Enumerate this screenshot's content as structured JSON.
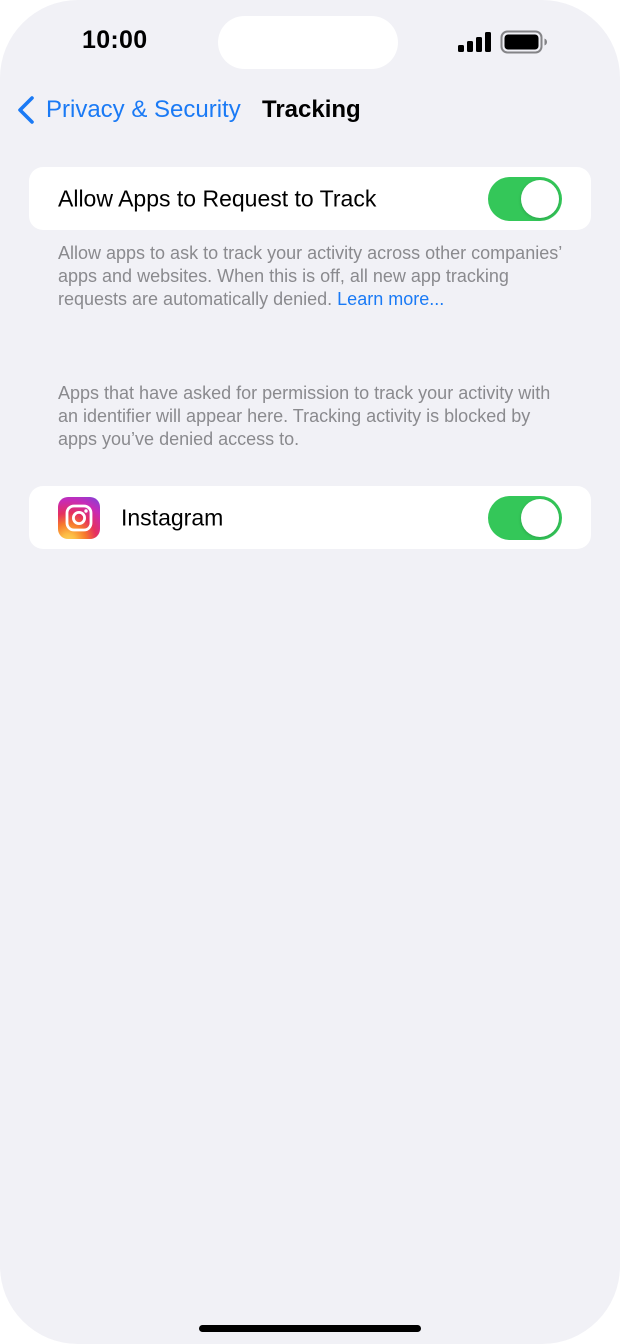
{
  "status_bar": {
    "time": "10:00",
    "signal_icon": "cellular-signal-icon",
    "battery_icon": "battery-icon"
  },
  "nav": {
    "back_label": "Privacy & Security",
    "back_icon": "chevron-left-icon",
    "title": "Tracking"
  },
  "allow_tracking": {
    "label": "Allow Apps to Request to Track",
    "enabled": true,
    "footnote_text": "Allow apps to ask to track your activity across other companies’ apps and websites. When this is off, all new app tracking requests are automatically denied. ",
    "learn_more": "Learn more..."
  },
  "apps_section": {
    "footnote": "Apps that have asked for permission to track your activity with an identifier will appear here. Tracking activity is blocked by apps you’ve denied access to.",
    "apps": [
      {
        "name": "Instagram",
        "icon": "instagram-icon",
        "enabled": true
      }
    ]
  },
  "colors": {
    "background": "#f1f1f6",
    "accent": "#1a7af5",
    "toggle_on": "#34c759",
    "footnote": "#8a8a8e"
  }
}
